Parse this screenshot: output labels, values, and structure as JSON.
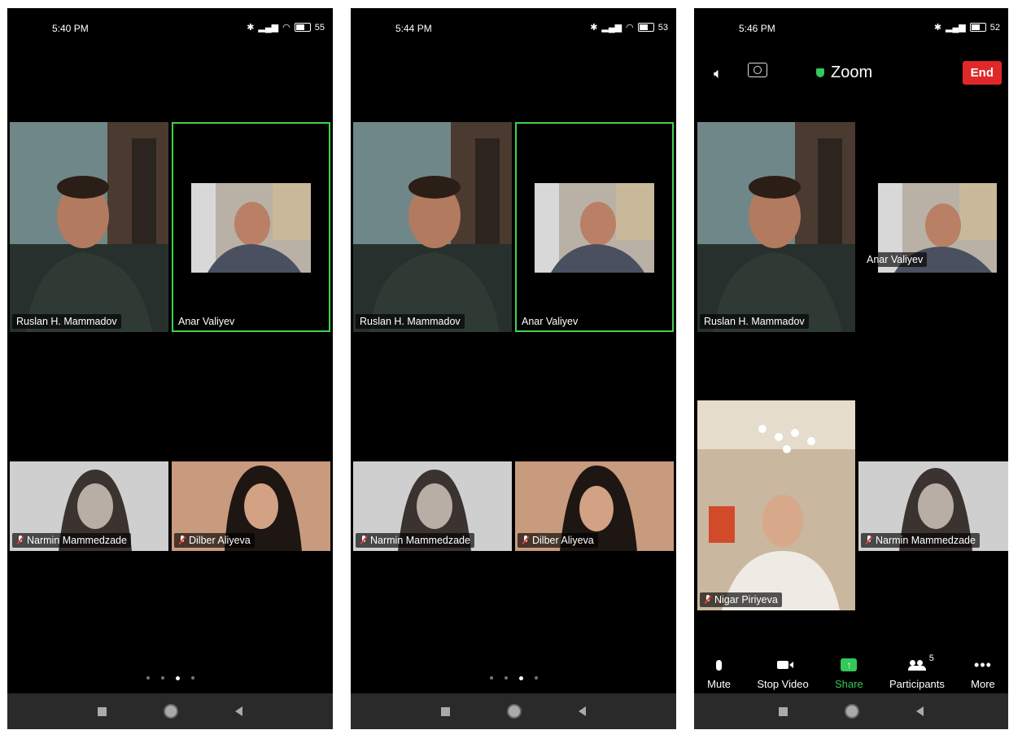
{
  "screens": [
    {
      "time": "5:40 PM",
      "battery": "55",
      "tiles": [
        {
          "name": "Ruslan H. Mammadov"
        },
        {
          "name": "Anar Valiyev"
        },
        {
          "name": "Narmin Mammedzade"
        },
        {
          "name": "Dilber Aliyeva"
        }
      ]
    },
    {
      "time": "5:44 PM",
      "battery": "53",
      "tiles": [
        {
          "name": "Ruslan H. Mammadov"
        },
        {
          "name": "Anar Valiyev"
        },
        {
          "name": "Narmin Mammedzade"
        },
        {
          "name": "Dilber Aliyeva"
        }
      ]
    },
    {
      "time": "5:46 PM",
      "battery": "52",
      "app_title": "Zoom",
      "end_label": "End",
      "tiles": [
        {
          "name": "Ruslan H. Mammadov"
        },
        {
          "name": "Anar Valiyev"
        },
        {
          "name": "Nigar Piriyeva"
        },
        {
          "name": "Narmin Mammedzade"
        }
      ],
      "toolbar": {
        "mute": "Mute",
        "stop_video": "Stop Video",
        "share": "Share",
        "participants": "Participants",
        "participant_count": "5",
        "more": "More"
      }
    }
  ],
  "colors": {
    "active_speaker": "#3fd24c",
    "end_button": "#e02828",
    "share": "#34c759"
  },
  "icons": [
    "bluetooth-icon",
    "signal-icon",
    "wifi-icon",
    "battery-icon",
    "speaker-icon",
    "camera-flip-icon",
    "shield-icon",
    "mic-icon",
    "video-icon",
    "share-icon",
    "participants-icon",
    "more-icon",
    "mic-muted-icon"
  ]
}
